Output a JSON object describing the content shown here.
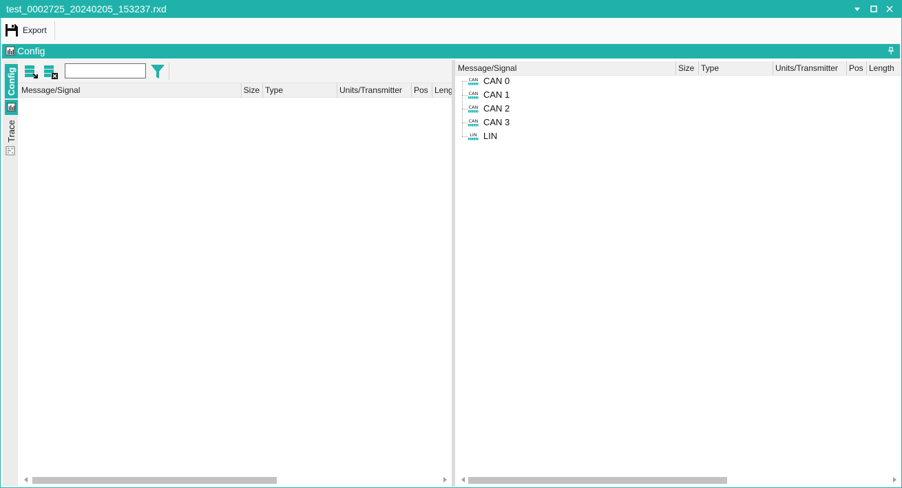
{
  "window": {
    "title": "test_0002725_20240205_153237.rxd",
    "accent": "#20b2aa"
  },
  "toolbar": {
    "export_label": "Export",
    "export_icon": "save-icon"
  },
  "panel": {
    "title": "Config",
    "pin_icon": "pin-icon"
  },
  "sidetabs": [
    {
      "label": "Config",
      "icon": "chart-icon",
      "active": true
    },
    {
      "label": "Trace",
      "icon": "trace-icon",
      "active": false
    }
  ],
  "left": {
    "search": {
      "value": "",
      "placeholder": ""
    },
    "columns": [
      "Message/Signal",
      "Size",
      "Type",
      "Units/Transmitter",
      "Pos",
      "Length"
    ]
  },
  "right": {
    "columns": [
      "Message/Signal",
      "Size",
      "Type",
      "Units/Transmitter",
      "Pos",
      "Length"
    ],
    "tree": [
      {
        "label": "CAN 0",
        "icon": "CAN"
      },
      {
        "label": "CAN 1",
        "icon": "CAN"
      },
      {
        "label": "CAN 2",
        "icon": "CAN"
      },
      {
        "label": "CAN 3",
        "icon": "CAN"
      },
      {
        "label": "LIN",
        "icon": "LIN"
      }
    ]
  }
}
